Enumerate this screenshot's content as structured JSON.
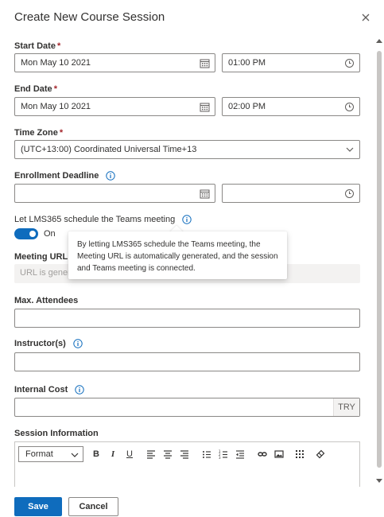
{
  "panel": {
    "title": "Create New Course Session"
  },
  "start_date": {
    "label": "Start Date",
    "date": "Mon May 10 2021",
    "time": "01:00 PM"
  },
  "end_date": {
    "label": "End Date",
    "date": "Mon May 10 2021",
    "time": "02:00 PM"
  },
  "time_zone": {
    "label": "Time Zone",
    "value": "(UTC+13:00) Coordinated Universal Time+13"
  },
  "enrollment_deadline": {
    "label": "Enrollment Deadline",
    "date": "",
    "time": ""
  },
  "teams_schedule": {
    "label": "Let LMS365 schedule the Teams meeting",
    "toggle_state": "On",
    "toggle_on": true
  },
  "tooltip": {
    "text": "By letting LMS365 schedule the Teams meeting, the Meeting URL is automatically generated, and the session and Teams meeting is connected."
  },
  "meeting_url": {
    "label": "Meeting URL",
    "placeholder": "URL is genera"
  },
  "max_attendees": {
    "label": "Max. Attendees",
    "value": ""
  },
  "instructors": {
    "label": "Instructor(s)",
    "value": ""
  },
  "internal_cost": {
    "label": "Internal Cost",
    "value": "",
    "currency": "TRY"
  },
  "session_info": {
    "label": "Session Information",
    "format_selected": "Format",
    "toolbar": {
      "bold": "B",
      "italic": "I",
      "underline": "U",
      "icons": [
        "align-left-icon",
        "align-center-icon",
        "align-right-icon",
        "bullet-list-icon",
        "numbered-list-icon",
        "outdent-icon",
        "link-icon",
        "image-icon",
        "table-icon",
        "clear-format-icon"
      ]
    }
  },
  "footer": {
    "save": "Save",
    "cancel": "Cancel"
  },
  "colors": {
    "accent": "#0f6cbd",
    "required": "#a4262c",
    "border": "#8a8886",
    "readonly_bg": "#f3f2f1"
  }
}
